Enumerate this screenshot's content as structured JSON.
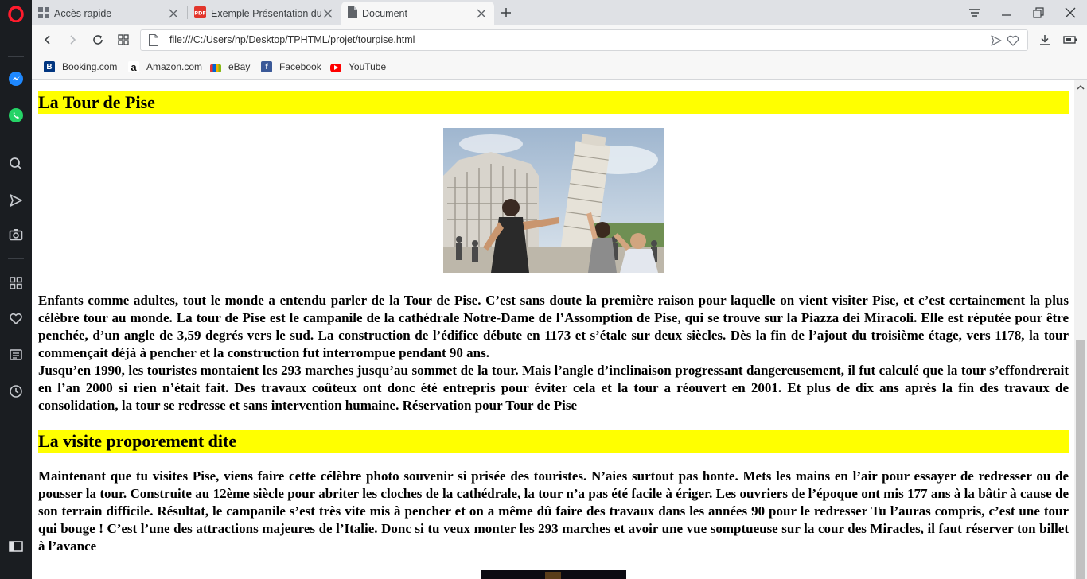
{
  "browser": {
    "tabs": [
      {
        "title": "Accès rapide",
        "icon": "grid-icon"
      },
      {
        "title": "Exemple Présentation du p",
        "icon": "pdf-icon"
      },
      {
        "title": "Document",
        "icon": "document-icon"
      }
    ],
    "url": "file:///C:/Users/hp/Desktop/TPHTML/projet/tourpise.html",
    "bookmarks": [
      {
        "label": "Booking.com",
        "icon": "booking-icon"
      },
      {
        "label": "Amazon.com",
        "icon": "amazon-icon"
      },
      {
        "label": "eBay",
        "icon": "ebay-icon"
      },
      {
        "label": "Facebook",
        "icon": "facebook-icon"
      },
      {
        "label": "YouTube",
        "icon": "youtube-icon"
      }
    ],
    "sidebar_icons": [
      "opera-logo-icon",
      "messenger-icon",
      "whatsapp-icon",
      "search-icon",
      "send-icon",
      "camera-icon",
      "speed-dial-icon",
      "heart-icon",
      "news-icon",
      "history-icon",
      "sidebar-toggle-icon"
    ],
    "colors": {
      "accent": "#ff1b2d",
      "sidebar": "#1a1d21",
      "highlight": "#ffff00"
    }
  },
  "page": {
    "section1_title": "La Tour de Pise",
    "section1_para1": "Enfants comme adultes, tout le monde a entendu parler de la Tour de Pise. C’est sans doute la première raison pour laquelle on vient visiter Pise, et c’est certainement la plus célèbre tour au monde. La tour de Pise est le campanile de la cathédrale Notre-Dame de l’Assomption de Pise, qui se trouve sur la Piazza dei Miracoli. Elle est réputée pour être penchée, d’un angle de 3,59 degrés vers le sud. La construction de l’édifice débute en 1173 et s’étale sur deux siècles. Dès la fin de l’ajout du troisième étage, vers 1178, la tour commençait déjà à pencher et la construction fut interrompue pendant 90 ans.",
    "section1_para2": "Jusqu’en 1990, les touristes montaient les 293 marches jusqu’au sommet de la tour. Mais l’angle d’inclinaison progressant dangereusement, il fut calculé que la tour s’effondrerait en l’an 2000 si rien n’était fait. Des travaux coûteux ont donc été entrepris pour éviter cela et la tour a réouvert en 2001. Et plus de dix ans après la fin des travaux de consolidation, la tour se redresse et sans intervention humaine. Réservation pour Tour de Pise",
    "section2_title": "La visite proporement dite",
    "section2_para": "Maintenant que tu visites Pise, viens faire cette célèbre photo souvenir si prisée des touristes. N’aies surtout pas honte. Mets les mains en l’air pour essayer de redresser ou de pousser la tour. Construite au 12ème siècle pour abriter les cloches de la cathédrale, la tour n’a pas été facile à ériger. Les ouvriers de l’époque ont mis 177 ans à la bâtir à cause de son terrain difficile. Résultat, le campanile s’est très vite mis à pencher et on a même dû faire des travaux dans les années 90 pour le redresser Tu l’auras compris, c’est une tour qui bouge ! C’est l’une des attractions majeures de l’Italie. Donc si tu veux monter les 293 marches et avoir une vue somptueuse sur la cour des Miracles, il faut réserver ton billet à l’avance"
  }
}
